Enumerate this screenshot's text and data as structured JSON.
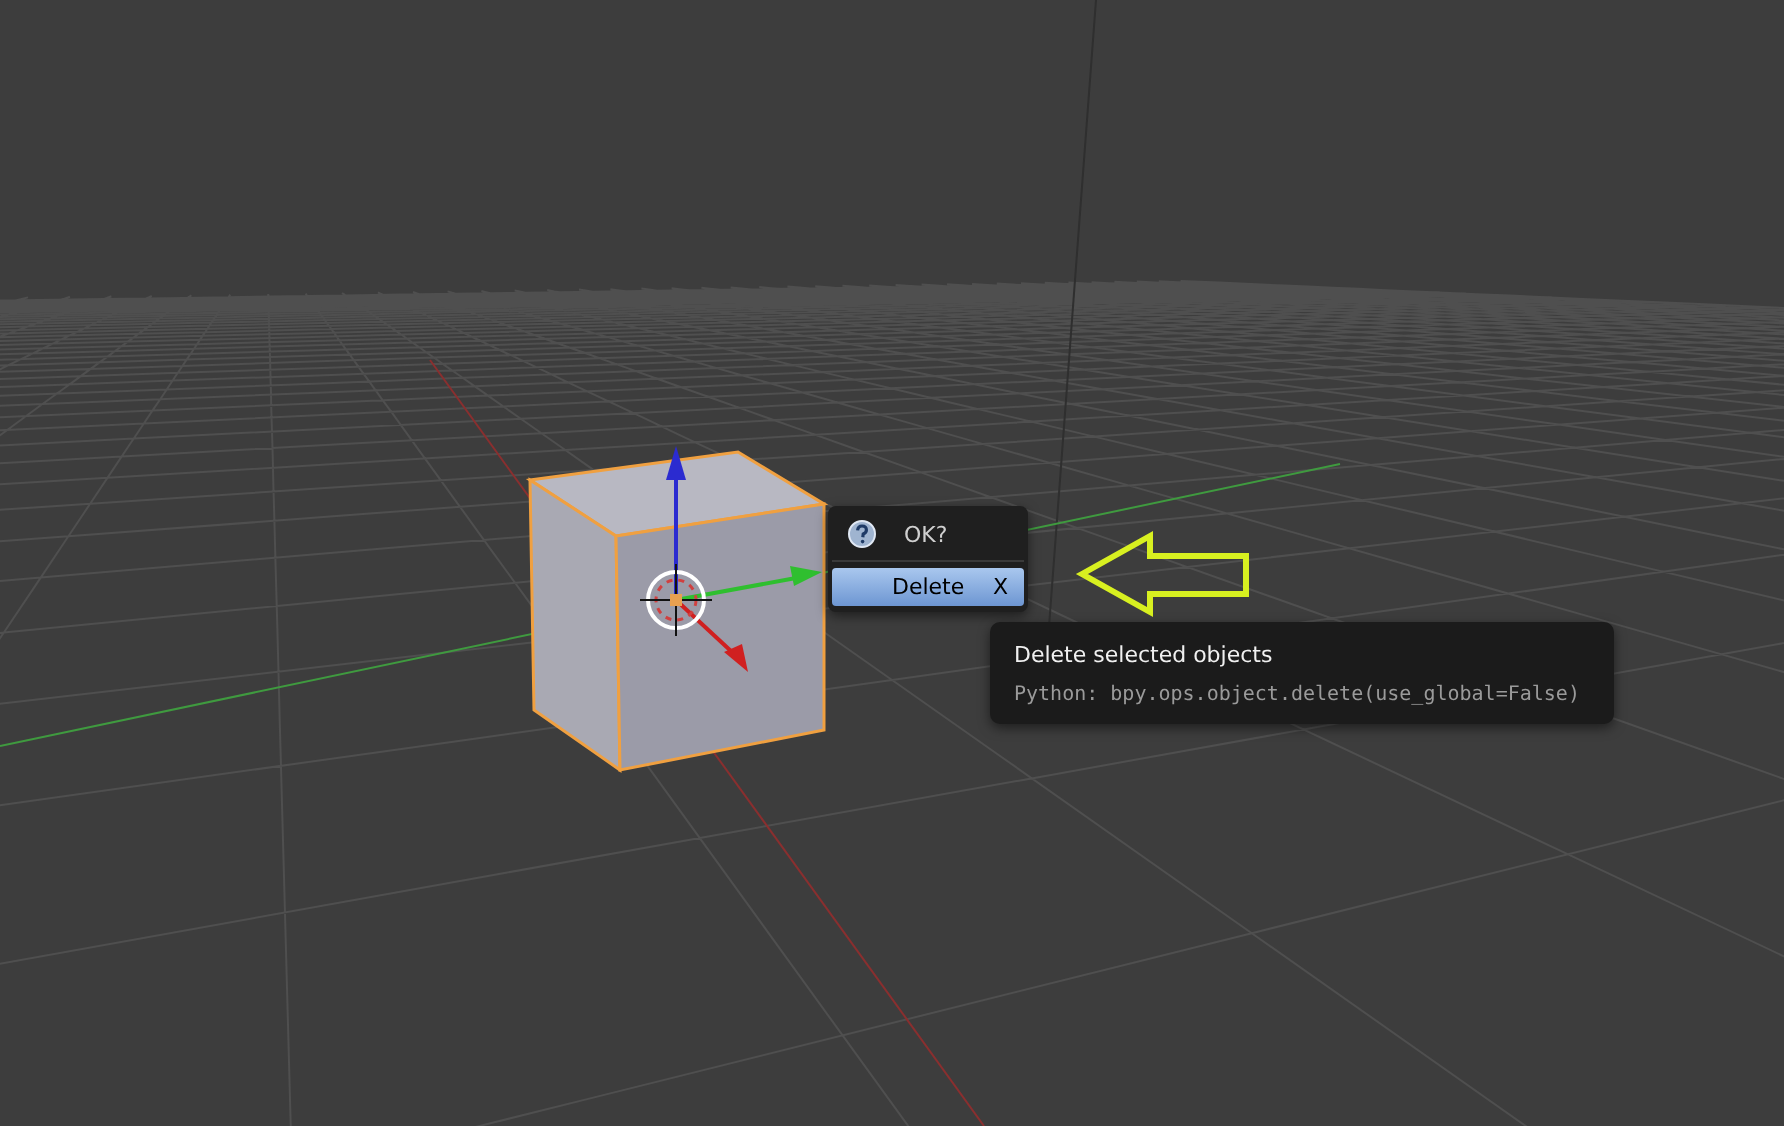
{
  "popup": {
    "title": "OK?",
    "items": [
      {
        "label": "Delete",
        "shortcut": "X",
        "selected": true
      }
    ]
  },
  "tooltip": {
    "description": "Delete selected objects",
    "python": "Python: bpy.ops.object.delete(use_global=False)"
  }
}
